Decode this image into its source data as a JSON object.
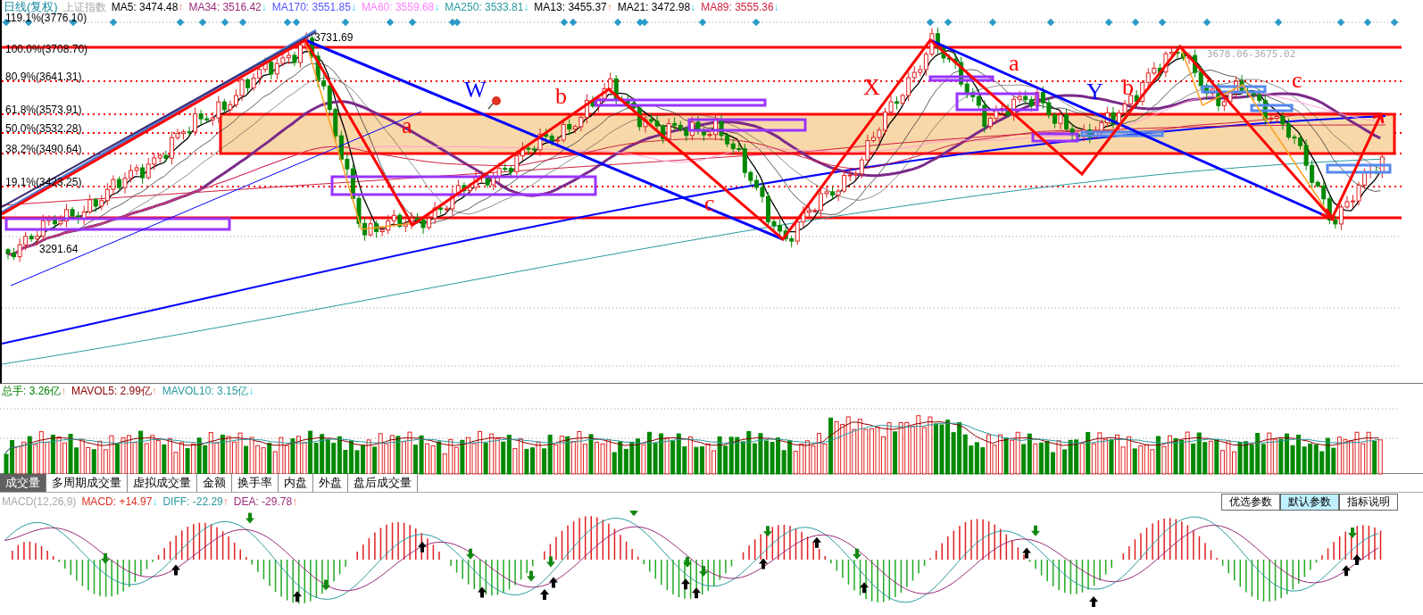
{
  "header": {
    "title": "日线(复权)",
    "index_name": "上证指数",
    "indicators": [
      {
        "label": "MA5: 3474.48",
        "arrow": "↑",
        "rising": true,
        "color": "#000000"
      },
      {
        "label": "MA34: 3516.42",
        "arrow": "↓",
        "rising": false,
        "color": "#9b2a7a"
      },
      {
        "label": "MA170: 3551.85",
        "arrow": "↓",
        "rising": false,
        "color": "#5555ff"
      },
      {
        "label": "MA60: 3559.68",
        "arrow": "↓",
        "rising": false,
        "color": "#ff80ff"
      },
      {
        "label": "MA250: 3533.81",
        "arrow": "↓",
        "rising": false,
        "color": "#2a9aa0"
      },
      {
        "label": "MA13: 3455.37",
        "arrow": "↑",
        "rising": true,
        "color": "#000000"
      },
      {
        "label": "MA21: 3472.98",
        "arrow": "↓",
        "rising": false,
        "color": "#000000"
      },
      {
        "label": "MA89: 3555.36",
        "arrow": "↓",
        "rising": false,
        "color": "#d02040"
      }
    ]
  },
  "fib_levels": [
    {
      "label": "119.1%(3776.10)"
    },
    {
      "label": "100.0%(3708.70)"
    },
    {
      "label": "80.9%(3641.31)"
    },
    {
      "label": "61.8%(3573.91)"
    },
    {
      "label": "50.0%(3532.28)"
    },
    {
      "label": "38.2%(3490.64)"
    },
    {
      "label": "19.1%(3423.25)"
    }
  ],
  "price_marks": [
    {
      "kind": "high",
      "text": "3731.69"
    },
    {
      "kind": "low",
      "text": "3291.64"
    },
    {
      "kind": "range",
      "text": "3678.06-3675.02"
    }
  ],
  "wave_labels": [
    {
      "text": "W",
      "color": "#0000ff"
    },
    {
      "text": "a",
      "color": "#ff0000"
    },
    {
      "text": "b",
      "color": "#ff0000"
    },
    {
      "text": "c",
      "color": "#ff0000"
    },
    {
      "text": "X",
      "color": "#ff0000"
    },
    {
      "text": "a",
      "color": "#ff0000"
    },
    {
      "text": "Y",
      "color": "#0000ff"
    },
    {
      "text": "b",
      "color": "#ff0000"
    },
    {
      "text": "c",
      "color": "#ff0000"
    }
  ],
  "volume": {
    "indicators": [
      {
        "label": "总手: 3.26亿",
        "arrow": "↑",
        "rising": true,
        "color": "#008000"
      },
      {
        "label": "MAVOL5: 2.99亿",
        "arrow": "↑",
        "rising": true,
        "color": "#8b0000"
      },
      {
        "label": "MAVOL10: 3.15亿",
        "arrow": "↓",
        "rising": false,
        "color": "#2a9aa0"
      }
    ],
    "tabs": [
      {
        "label": "成交量",
        "selected": true
      },
      {
        "label": "多周期成交量",
        "selected": false
      },
      {
        "label": "虚拟成交量",
        "selected": false
      },
      {
        "label": "金额",
        "selected": false
      },
      {
        "label": "换手率",
        "selected": false
      },
      {
        "label": "内盘",
        "selected": false
      },
      {
        "label": "外盘",
        "selected": false
      },
      {
        "label": "盘后成交量",
        "selected": false
      }
    ]
  },
  "macd": {
    "name": "MACD(12,26,9)",
    "indicators": [
      {
        "label": "MACD: +14.97",
        "arrow": "↓",
        "rising": false,
        "color": "#e03020"
      },
      {
        "label": "DIFF: -22.29",
        "arrow": "↑",
        "rising": true,
        "color": "#2a9aa0"
      },
      {
        "label": "DEA: -29.78",
        "arrow": "↑",
        "rising": true,
        "color": "#9b2a7a"
      }
    ],
    "buttons": [
      {
        "label": "优选参数",
        "selected": false
      },
      {
        "label": "默认参数",
        "selected": true
      },
      {
        "label": "指标说明",
        "selected": false
      }
    ]
  }
}
